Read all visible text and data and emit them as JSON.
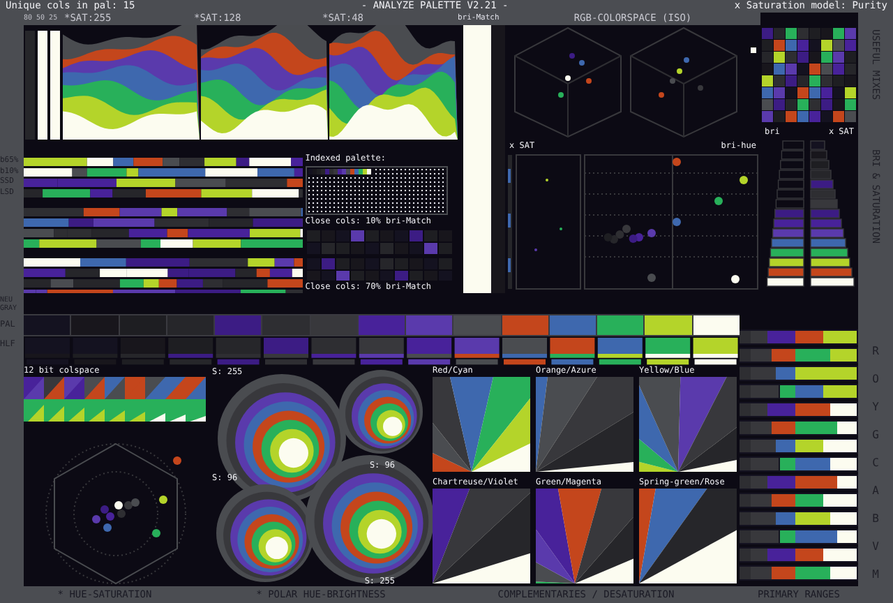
{
  "header": {
    "count_label": "Unique cols in pal: 15",
    "title": "- ANALYZE PALETTE V2.21 -",
    "model": "x Saturation model: Purity"
  },
  "wave_panel": {
    "scale": "80 50 25",
    "labels": [
      "*SAT:255",
      "*SAT:128",
      "*SAT:48"
    ],
    "match_label": "bri-Match"
  },
  "rgb_panel": {
    "title": "RGB-COLORSPACE (ISO)"
  },
  "side_labels": {
    "useful": "USEFUL MIXES",
    "brisat": "BRI & SATURATION",
    "hues": [
      "R",
      "O",
      "Y",
      "G",
      "C",
      "A",
      "B",
      "V",
      "M"
    ]
  },
  "stripe_labels": [
    "b65%",
    "b10%",
    "SSD",
    "LSD"
  ],
  "gray_labels": [
    "NEU GRAY",
    "PAL",
    "HLF"
  ],
  "indexed": {
    "title": "Indexed palette:",
    "close_10": "Close cols: 10% bri-Match",
    "close_70": "Close cols: 70% bri-Match"
  },
  "sat_panel": {
    "left": "x SAT",
    "right": "bri-hue"
  },
  "brisat_panel": {
    "left": "bri",
    "right": "x SAT"
  },
  "colspace": {
    "title": "12 bit colspace"
  },
  "polar": {
    "labels": [
      "S: 255",
      "S: 96",
      "S: 96",
      "S: 255"
    ]
  },
  "complementaries": [
    {
      "label": "Red/Cyan"
    },
    {
      "label": "Orange/Azure"
    },
    {
      "label": "Yellow/Blue"
    },
    {
      "label": "Chartreuse/Violet"
    },
    {
      "label": "Green/Magenta"
    },
    {
      "label": "Spring-green/Rose"
    }
  ],
  "footer": [
    "* HUE-SATURATION",
    "* POLAR HUE-BRIGHTNESS",
    "COMPLEMENTARIES / DESATURATION",
    "PRIMARY RANGES"
  ],
  "palette": [
    {
      "color": "#141220"
    },
    {
      "color": "#18161c"
    },
    {
      "color": "#1e1e22"
    },
    {
      "color": "#26262a"
    },
    {
      "color": "#3c1c84"
    },
    {
      "color": "#2e2e32"
    },
    {
      "color": "#38383c"
    },
    {
      "color": "#48229a"
    },
    {
      "color": "#5a3aac"
    },
    {
      "color": "#4a4c50"
    },
    {
      "color": "#c4461c"
    },
    {
      "color": "#3e68ae"
    },
    {
      "color": "#28b05a"
    },
    {
      "color": "#b4d42a"
    },
    {
      "color": "#fcfcf0"
    }
  ]
}
